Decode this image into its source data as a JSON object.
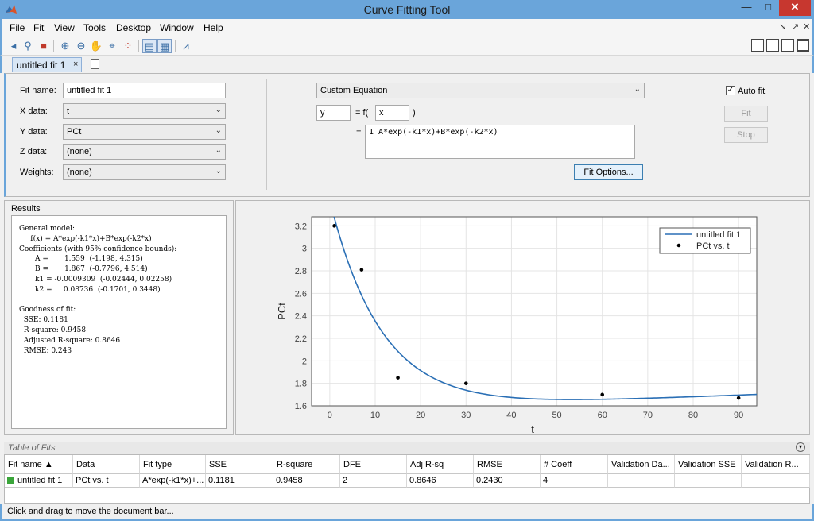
{
  "window": {
    "title": "Curve Fitting Tool",
    "min": "—",
    "max": "□",
    "close": "✕"
  },
  "menu": [
    "File",
    "Fit",
    "View",
    "Tools",
    "Desktop",
    "Window",
    "Help"
  ],
  "dock_controls": [
    "↘",
    "↗",
    "✕"
  ],
  "toolbar": {
    "icons": [
      "pan-icon",
      "data-cursor-icon",
      "colormap-icon",
      "zoom-in-icon",
      "zoom-out-icon",
      "hand-pan-icon",
      "data-tip-icon",
      "exclude-icon",
      "legend-toggle-icon",
      "grid-toggle-icon",
      "residuals-icon"
    ]
  },
  "tab": {
    "label": "untitled fit 1",
    "close": "×"
  },
  "fit": {
    "name_label": "Fit name:",
    "name_value": "untitled fit 1",
    "x_label": "X data:",
    "x_value": "t",
    "y_label": "Y data:",
    "y_value": "PCt",
    "z_label": "Z data:",
    "z_value": "(none)",
    "w_label": "Weights:",
    "w_value": "(none)",
    "type_value": "Custom Equation",
    "dep_var": "y",
    "eq_sign": "= f(",
    "indep_var": "x",
    "close_paren": ")",
    "eq_prefix": "=",
    "equation": "1  A*exp(-k1*x)+B*exp(-k2*x)",
    "options_label": "Fit Options...",
    "autofit_label": "Auto fit",
    "fit_btn": "Fit",
    "stop_btn": "Stop"
  },
  "results": {
    "title": "Results",
    "text": "General model:\n     f(x) = A*exp(-k1*x)+B*exp(-k2*x)\nCoefficients (with 95% confidence bounds):\n       A =       1.559  (-1.198, 4.315)\n       B =       1.867  (-0.7796, 4.514)\n       k1 = -0.0009309  (-0.02444, 0.02258)\n       k2 =     0.08736  (-0.1701, 0.3448)\n\nGoodness of fit:\n  SSE: 0.1181\n  R-square: 0.9458\n  Adjusted R-square: 0.8646\n  RMSE: 0.243"
  },
  "chart_data": {
    "type": "line",
    "xlabel": "t",
    "ylabel": "PCt",
    "xlim": [
      -4,
      94
    ],
    "ylim": [
      1.6,
      3.28
    ],
    "xticks": [
      "0",
      "10",
      "20",
      "30",
      "40",
      "50",
      "60",
      "70",
      "80",
      "90"
    ],
    "yticks": [
      "1.6",
      "1.8",
      "2",
      "2.2",
      "2.4",
      "2.6",
      "2.8",
      "3",
      "3.2"
    ],
    "grid": true,
    "legend_placement": "top-right",
    "series": [
      {
        "name": "untitled fit 1",
        "kind": "line",
        "model": "A*exp(-k1*x)+B*exp(-k2*x)",
        "A": 1.559,
        "B": 1.867,
        "k1": -0.0009309,
        "k2": 0.08736,
        "color": "#2a6fb5"
      },
      {
        "name": "PCt vs. t",
        "kind": "scatter",
        "x": [
          1,
          7,
          15,
          30,
          60,
          90
        ],
        "y": [
          3.2,
          2.81,
          1.85,
          1.8,
          1.7,
          1.67
        ],
        "color": "#000000"
      }
    ]
  },
  "table": {
    "title": "Table of Fits",
    "columns": [
      "Fit name ▲",
      "Data",
      "Fit type",
      "SSE",
      "R-square",
      "DFE",
      "Adj R-sq",
      "RMSE",
      "# Coeff",
      "Validation Da...",
      "Validation SSE",
      "Validation R..."
    ],
    "row": [
      "untitled fit 1",
      "PCt vs. t",
      "A*exp(-k1*x)+...",
      "0.1181",
      "0.9458",
      "2",
      "0.8646",
      "0.2430",
      "4",
      "",
      "",
      ""
    ],
    "status_color": "#3aa53a"
  },
  "status": "Click and drag to move the document bar..."
}
